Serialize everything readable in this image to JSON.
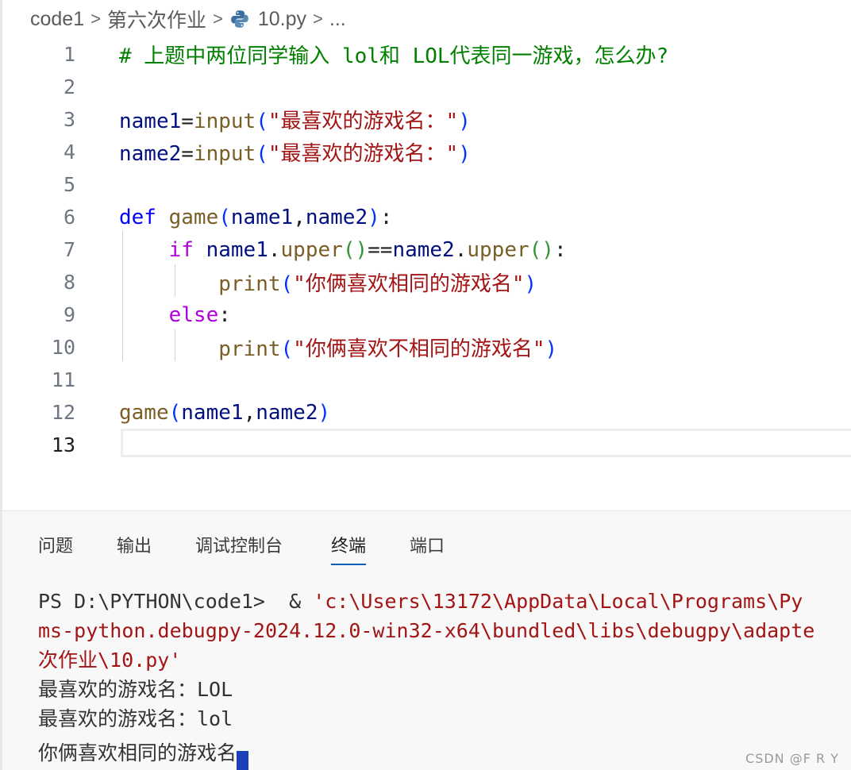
{
  "breadcrumb": {
    "items": [
      "code1",
      "第六次作业",
      "10.py",
      "..."
    ],
    "separator": ">"
  },
  "editor": {
    "line_numbers": [
      "1",
      "2",
      "3",
      "4",
      "5",
      "6",
      "7",
      "8",
      "9",
      "10",
      "11",
      "12",
      "13"
    ],
    "active_line": "13",
    "lines": {
      "l1": {
        "comment": "# 上题中两位同学输入 lol和 LOL代表同一游戏，怎么办?"
      },
      "l3": {
        "var": "name1",
        "op": "=",
        "func": "input",
        "lp": "(",
        "str": "\"最喜欢的游戏名：\"",
        "rp": ")"
      },
      "l4": {
        "var": "name2",
        "op": "=",
        "func": "input",
        "lp": "(",
        "str": "\"最喜欢的游戏名：\"",
        "rp": ")"
      },
      "l6": {
        "kw": "def",
        "func": "game",
        "lp": "(",
        "a1": "name1",
        "comma": ",",
        "a2": "name2",
        "rp": ")",
        "colon": ":"
      },
      "l7": {
        "kw": "if",
        "v1": "name1",
        "dot1": ".",
        "m1": "upper",
        "p1": "()",
        "eq": "==",
        "v2": "name2",
        "dot2": ".",
        "m2": "upper",
        "p2": "()",
        "colon": ":"
      },
      "l8": {
        "func": "print",
        "lp": "(",
        "str": "\"你俩喜欢相同的游戏名\"",
        "rp": ")"
      },
      "l9": {
        "kw": "else",
        "colon": ":"
      },
      "l10": {
        "func": "print",
        "lp": "(",
        "str": "\"你俩喜欢不相同的游戏名\"",
        "rp": ")"
      },
      "l12": {
        "func": "game",
        "lp": "(",
        "a1": "name1",
        "comma": ",",
        "a2": "name2",
        "rp": ")"
      }
    }
  },
  "panel": {
    "tabs": [
      "问题",
      "输出",
      "调试控制台",
      "终端",
      "端口"
    ],
    "active_tab": "终端"
  },
  "terminal": {
    "prompt": "PS D:\\PYTHON\\code1>",
    "amp": "  & ",
    "cmd_part1": "'c:\\Users\\13172\\AppData\\Local\\Programs\\Py",
    "cmd_part2": "ms-python.debugpy-2024.12.0-win32-x64\\bundled\\libs\\debugpy\\adapte",
    "cmd_part3": "次作业\\10.py'",
    "out1": "最喜欢的游戏名：LOL",
    "out2": "最喜欢的游戏名：lol",
    "out3": "你俩喜欢相同的游戏名"
  },
  "watermark": "CSDN @F R Y",
  "colors": {
    "comment": "#008000",
    "variable": "#001080",
    "function": "#795e26",
    "string": "#a31515",
    "keyword": "#0000ff",
    "control": "#af00db",
    "tab_underline": "#005fb8"
  },
  "icons": {
    "file": "python-icon"
  }
}
